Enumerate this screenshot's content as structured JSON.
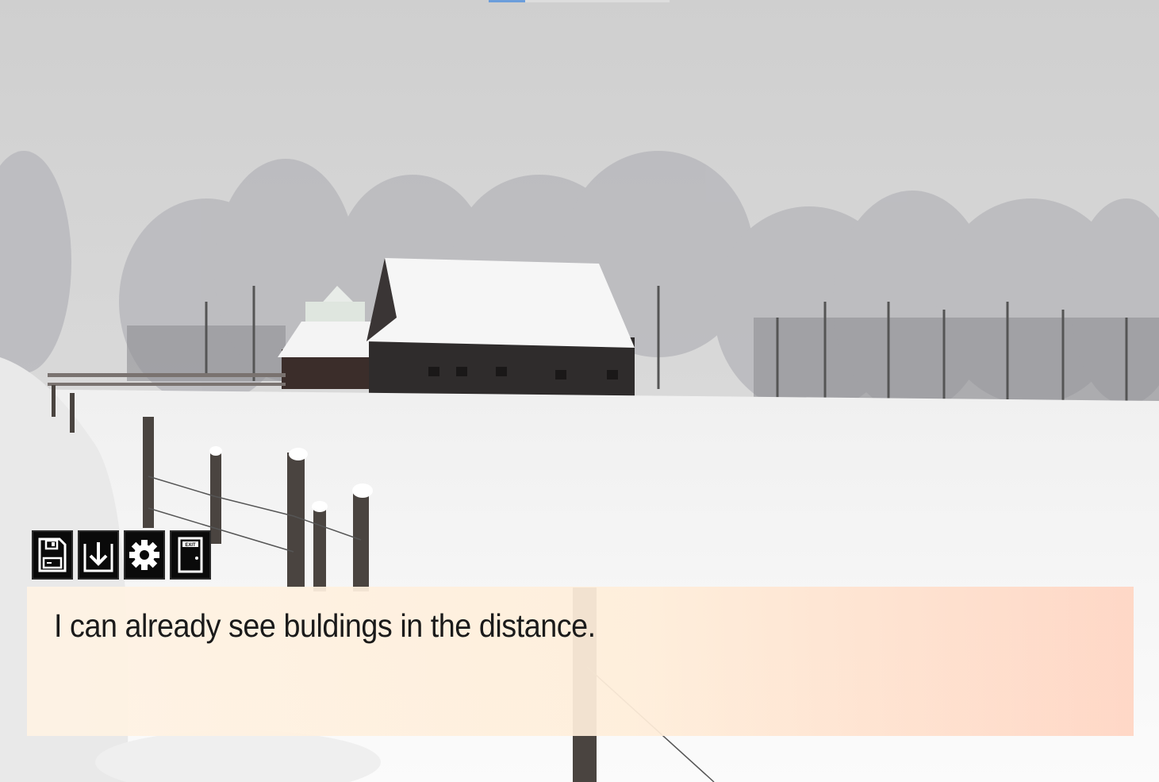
{
  "dialog": {
    "text": "I can already see buldings in the distance."
  },
  "toolbar": {
    "buttons": [
      {
        "icon": "save-icon"
      },
      {
        "icon": "load-icon"
      },
      {
        "icon": "settings-icon"
      },
      {
        "icon": "exit-icon",
        "sign": "EXIT"
      }
    ]
  },
  "colors": {
    "dialog_bg": "#ffeedd",
    "button_bg": "#0a0a0a",
    "text": "#1a1a1a"
  }
}
